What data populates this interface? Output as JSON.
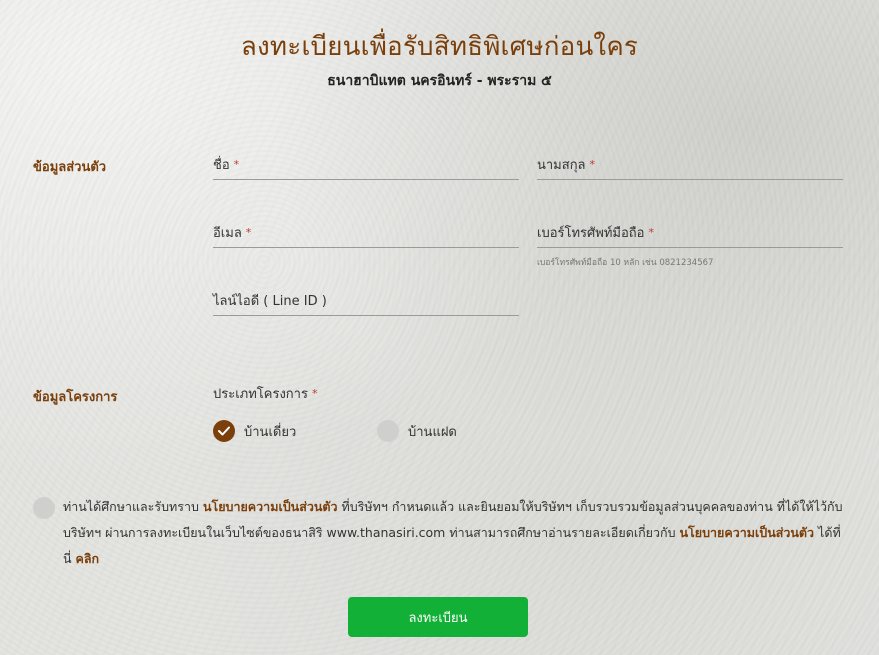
{
  "header": {
    "title": "ลงทะเบียนเพื่อรับสิทธิพิเศษก่อนใคร",
    "subtitle": "ธนาฮาบิแทต นครอินทร์ - พระราม ๕"
  },
  "personal": {
    "section_label": "ข้อมูลส่วนตัว",
    "first_name_label": "ชื่อ",
    "last_name_label": "นามสกุล",
    "email_label": "อีเมล",
    "phone_label": "เบอร์โทรศัพท์มือถือ",
    "phone_hint": "เบอร์โทรศัพท์มือถือ 10 หลัก เช่น 0821234567",
    "line_id_label": "ไลน์ไอดี ( Line ID )",
    "required_mark": "*"
  },
  "project": {
    "section_label": "ข้อมูลโครงการ",
    "type_label": "ประเภทโครงการ",
    "options": [
      {
        "label": "บ้านเดี่ยว",
        "selected": true
      },
      {
        "label": "บ้านแฝด",
        "selected": false
      }
    ]
  },
  "consent": {
    "text_1": "ท่านได้ศึกษาและรับทราบ ",
    "link_1": "นโยบายความเป็นส่วนตัว",
    "text_2": " ที่บริษัทฯ กำหนดแล้ว และยินยอมให้บริษัทฯ เก็บรวบรวมข้อมูลส่วนบุคคลของท่าน ที่ได้ให้ไว้กับบริษัทฯ ผ่านการลงทะเบียนในเว็บไซต์ของธนาสิริ www.thanasiri.com ท่านสามารถศึกษาอ่านรายละเอียดเกี่ยวกับ ",
    "link_2": "นโยบายความเป็นส่วนตัว",
    "text_3": " ได้ที่นี่ ",
    "link_3": "คลิก"
  },
  "submit_label": "ลงทะเบียน",
  "colors": {
    "accent": "#7a3f0b",
    "submit": "#12b036",
    "required": "#c0392b"
  }
}
